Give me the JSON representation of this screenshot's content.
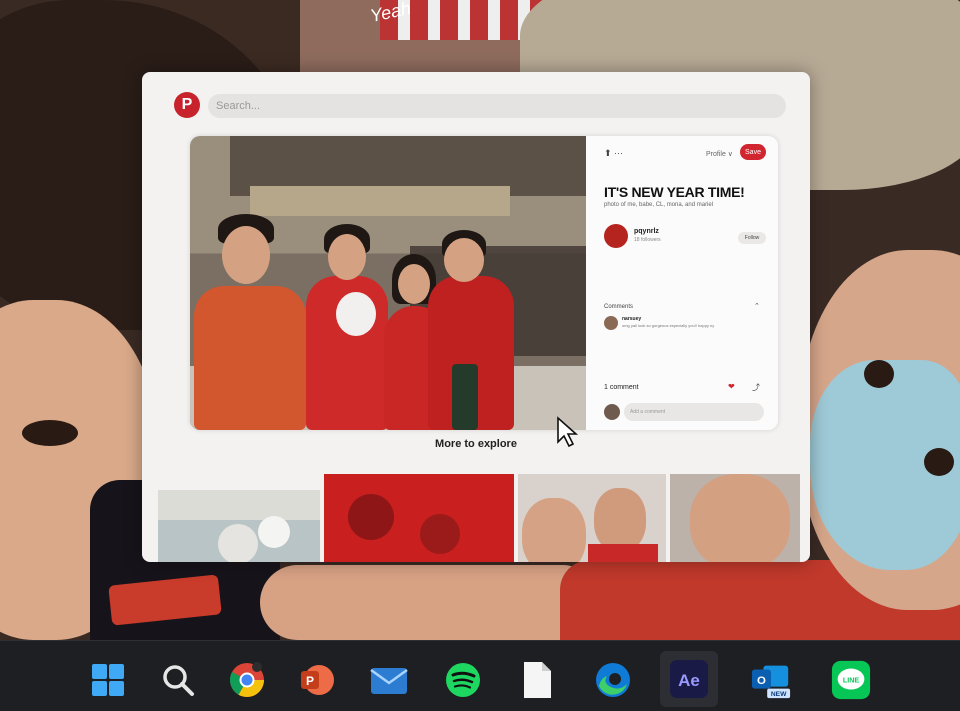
{
  "background": {
    "handwriting": "Yeah"
  },
  "window": {
    "logo": "P",
    "search_placeholder": "Search...",
    "pin": {
      "side_icons": "⬆ ···",
      "profile_link": "Profile ∨",
      "save_label": "Save",
      "title": "IT'S NEW YEAR TIME!",
      "description": "photo of me, babe, CL, mona, and mariel",
      "author_name": "pqynrlz",
      "author_followers": "18 followers",
      "follow_label": "Follow",
      "comments_label": "Comments",
      "commenter_name": "narsuey",
      "comment_text": "omg yall look so gorgeous especially you!! happy ny",
      "comment_count": "1 comment",
      "comment_placeholder": "Add a comment"
    },
    "more_to_explore": "More to explore"
  },
  "taskbar": {
    "items": [
      {
        "name": "start",
        "label": "Start"
      },
      {
        "name": "search",
        "label": "Search"
      },
      {
        "name": "chrome",
        "label": "Chrome"
      },
      {
        "name": "powerpoint",
        "label": "P"
      },
      {
        "name": "mail",
        "label": "Mail"
      },
      {
        "name": "spotify",
        "label": "Spotify"
      },
      {
        "name": "file",
        "label": "File"
      },
      {
        "name": "edge",
        "label": "Edge"
      },
      {
        "name": "after-effects",
        "label": "Ae"
      },
      {
        "name": "outlook",
        "label": "O",
        "badge": "NEW"
      },
      {
        "name": "line",
        "label": "LINE"
      }
    ]
  },
  "colors": {
    "pinterest_red": "#c8232c",
    "taskbar_bg": "#1d1f22",
    "window_bg": "#f3f2f1"
  }
}
